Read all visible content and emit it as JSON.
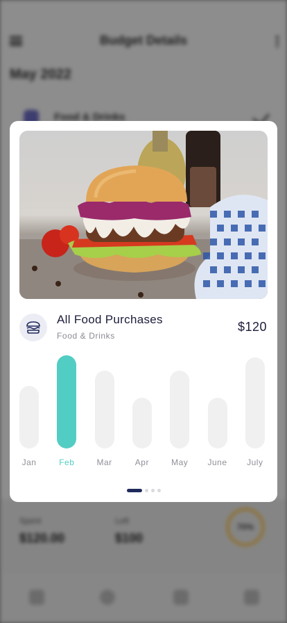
{
  "background": {
    "header_title": "Budget Details",
    "month": "May 2022",
    "item_label": "Food & Drinks",
    "stats": [
      {
        "label": "Spent",
        "value": "$120.00"
      },
      {
        "label": "Left",
        "value": "$100"
      }
    ],
    "ring_text": "70%"
  },
  "card": {
    "title": "All Food Purchases",
    "subtitle": "Food & Drinks",
    "amount": "$120",
    "category_icon": "burger-icon",
    "photo_alt": "burger-photo"
  },
  "chart_data": {
    "type": "bar",
    "categories": [
      "Jan",
      "Feb",
      "Mar",
      "Apr",
      "May",
      "June",
      "July"
    ],
    "values": [
      90,
      134,
      112,
      73,
      112,
      73,
      131
    ],
    "selected": "Feb",
    "colors": {
      "active": "#52cdc3",
      "inactive": "#f0f0f0"
    }
  },
  "pagination": {
    "count": 4,
    "active_index": 0
  }
}
